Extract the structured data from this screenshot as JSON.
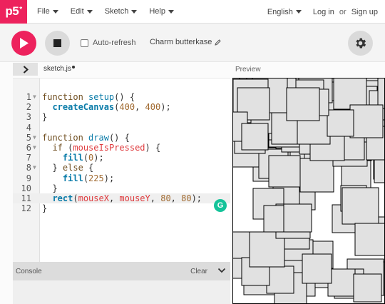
{
  "logo": {
    "text": "p5",
    "mark": "*"
  },
  "menu": [
    {
      "label": "File"
    },
    {
      "label": "Edit"
    },
    {
      "label": "Sketch"
    },
    {
      "label": "Help"
    }
  ],
  "nav_right": {
    "language": "English",
    "login": "Log in",
    "or": "or",
    "signup": "Sign up"
  },
  "toolbar": {
    "auto_refresh_label": "Auto-refresh",
    "auto_refresh_checked": false,
    "sketch_name": "Charm butterkase"
  },
  "file_tab": {
    "name": "sketch.js",
    "unsaved": true
  },
  "preview_label": "Preview",
  "code": [
    {
      "n": "1",
      "fold": true,
      "tokens": [
        [
          "kw",
          "function "
        ],
        [
          "def",
          "setup"
        ],
        [
          "plain",
          "() {"
        ]
      ]
    },
    {
      "n": "2",
      "fold": false,
      "tokens": [
        [
          "plain",
          "  "
        ],
        [
          "fn",
          "createCanvas"
        ],
        [
          "plain",
          "("
        ],
        [
          "num",
          "400"
        ],
        [
          "plain",
          ", "
        ],
        [
          "num",
          "400"
        ],
        [
          "plain",
          ");"
        ]
      ]
    },
    {
      "n": "3",
      "fold": false,
      "tokens": [
        [
          "plain",
          "}"
        ]
      ]
    },
    {
      "n": "4",
      "fold": false,
      "tokens": []
    },
    {
      "n": "5",
      "fold": true,
      "tokens": [
        [
          "kw",
          "function "
        ],
        [
          "def",
          "draw"
        ],
        [
          "plain",
          "() {"
        ]
      ]
    },
    {
      "n": "6",
      "fold": true,
      "tokens": [
        [
          "plain",
          "  "
        ],
        [
          "kw",
          "if "
        ],
        [
          "plain",
          "("
        ],
        [
          "var",
          "mouseIsPressed"
        ],
        [
          "plain",
          ") {"
        ]
      ]
    },
    {
      "n": "7",
      "fold": false,
      "tokens": [
        [
          "plain",
          "    "
        ],
        [
          "fn",
          "fill"
        ],
        [
          "plain",
          "("
        ],
        [
          "num",
          "0"
        ],
        [
          "plain",
          ");"
        ]
      ]
    },
    {
      "n": "8",
      "fold": true,
      "tokens": [
        [
          "plain",
          "  } "
        ],
        [
          "kw",
          "else"
        ],
        [
          "plain",
          " {"
        ]
      ]
    },
    {
      "n": "9",
      "fold": false,
      "tokens": [
        [
          "plain",
          "    "
        ],
        [
          "fn",
          "fill"
        ],
        [
          "plain",
          "("
        ],
        [
          "num",
          "225"
        ],
        [
          "plain",
          ");"
        ]
      ]
    },
    {
      "n": "10",
      "fold": false,
      "tokens": [
        [
          "plain",
          "  }"
        ]
      ]
    },
    {
      "n": "11",
      "fold": false,
      "active": true,
      "tokens": [
        [
          "plain",
          "  "
        ],
        [
          "fn",
          "rect"
        ],
        [
          "plain",
          "("
        ],
        [
          "var",
          "mouseX"
        ],
        [
          "plain",
          ", "
        ],
        [
          "var",
          "mouseY"
        ],
        [
          "plain",
          ", "
        ],
        [
          "num",
          "80"
        ],
        [
          "plain",
          ", "
        ],
        [
          "num",
          "80"
        ],
        [
          "plain",
          ");"
        ]
      ]
    },
    {
      "n": "12",
      "fold": false,
      "tokens": [
        [
          "plain",
          "}"
        ]
      ]
    }
  ],
  "grammarly_badge": "G",
  "console": {
    "title": "Console",
    "clear_label": "Clear"
  },
  "colors": {
    "accent": "#ed225d",
    "rect_fill": "#e1e1e1",
    "rect_stroke": "#000000",
    "grammarly": "#15c39a"
  },
  "icons": {
    "play": "play-icon",
    "stop": "stop-icon",
    "settings": "gear-icon",
    "expand": "chevron-right-icon",
    "collapse_console": "chevron-down-icon",
    "edit": "pencil-icon"
  }
}
